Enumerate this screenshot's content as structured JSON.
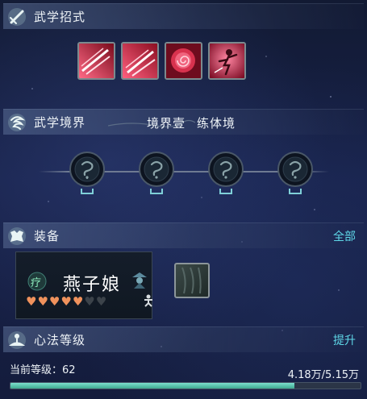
{
  "martial_moves": {
    "title": "武学招式",
    "icon": "sword-slash-icon",
    "skills": [
      {
        "icon": "claw-slash-icon"
      },
      {
        "icon": "claw-slash-icon"
      },
      {
        "icon": "rose-swirl-icon"
      },
      {
        "icon": "dancer-figure-icon"
      }
    ]
  },
  "realm": {
    "title": "武学境界",
    "icon": "spiral-wind-icon",
    "level_name": "境界壹",
    "stage_name": "练体境",
    "nodes": [
      {
        "state": "locked"
      },
      {
        "state": "locked"
      },
      {
        "state": "locked"
      },
      {
        "state": "locked"
      }
    ]
  },
  "equipment": {
    "title": "装备",
    "icon": "armor-icon",
    "all_label": "全部",
    "card": {
      "badge": "疗",
      "name": "燕子娘",
      "hearts_filled": 5,
      "hearts_total": 7
    }
  },
  "mind_method": {
    "title": "心法等级",
    "icon": "meditation-icon",
    "upgrade_label": "提升",
    "level_text": "当前等级：62",
    "exp_text": "4.18万/5.15万",
    "progress": 0.81
  },
  "colors": {
    "accent": "#5fd8e8",
    "heart": "#f0925c",
    "progress": "#5cc6ad"
  }
}
